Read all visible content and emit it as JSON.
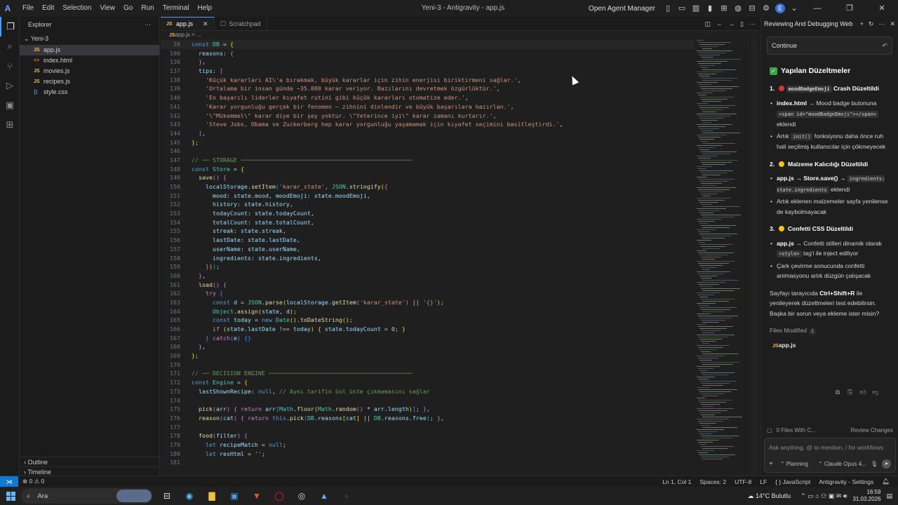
{
  "app": {
    "menu": [
      "File",
      "Edit",
      "Selection",
      "View",
      "Go",
      "Run",
      "Terminal",
      "Help"
    ],
    "window_title": "Yeni-3 - Antigravity - app.js",
    "open_agent_manager": "Open Agent Manager",
    "avatar_letter": "E"
  },
  "explorer": {
    "title": "Explorer",
    "folder": "Yeni-3",
    "files": [
      {
        "name": "app.js",
        "type": "JS"
      },
      {
        "name": "index.html",
        "type": "<>"
      },
      {
        "name": "movies.js",
        "type": "JS"
      },
      {
        "name": "recipes.js",
        "type": "JS"
      },
      {
        "name": "style.css",
        "type": "{}"
      }
    ],
    "outline": "Outline",
    "timeline": "Timeline"
  },
  "editor": {
    "tabs": [
      {
        "label": "app.js",
        "active": true
      },
      {
        "label": "Scratchpad",
        "active": false
      }
    ],
    "breadcrumb": "app.js > ...",
    "lines": [
      {
        "n": "20",
        "html": "<span class=\"kw\">const</span> <span class=\"cls\">DB</span> = <span class=\"brk\">{</span>"
      },
      {
        "n": "100",
        "html": "  <span class=\"var\">reasons</span>: <span class=\"brk2\">{</span>"
      },
      {
        "n": "136",
        "html": "  <span class=\"brk2\">}</span>,"
      },
      {
        "n": "137",
        "html": "  <span class=\"var\">tips</span>: <span class=\"brk2\">[</span>"
      },
      {
        "n": "138",
        "html": "    <span class=\"str\">'Küçük kararları AI\\'a bırakmak, büyük kararlar için zihin enerjisi biriktirmeni sağlar.'</span>,"
      },
      {
        "n": "139",
        "html": "    <span class=\"str\">'Ortalama bir insan günde ~35.000 karar veriyor. Bazılarını devretmek özgürlüktür.'</span>,"
      },
      {
        "n": "140",
        "html": "    <span class=\"str\">'En başarılı liderler kıyafet rutini gibi küçük kararları otomatize eder.'</span>,"
      },
      {
        "n": "141",
        "html": "    <span class=\"str\">'Karar yorgunluğu gerçek bir fenomen — zihnini dinlendir ve büyük başarılara hazırlan.'</span>,"
      },
      {
        "n": "142",
        "html": "    <span class=\"str\">'\\\"Mükemmel\\\" karar diye bir şey yoktur. \\\"Yeterince iyi\\\" karar zamanı kurtarır.'</span>,"
      },
      {
        "n": "143",
        "html": "    <span class=\"str\">'Steve Jobs, Obama ve Zuckerberg hep karar yorgunluğu yaşamamak için kıyafet seçimini basitleştirdi.'</span>,"
      },
      {
        "n": "144",
        "html": "  <span class=\"brk2\">]</span>,"
      },
      {
        "n": "145",
        "html": "<span class=\"brk\">}</span>;"
      },
      {
        "n": "146",
        "html": ""
      },
      {
        "n": "147",
        "html": "<span class=\"com\">// ── STORAGE ─────────────────────────────────────────────────</span>"
      },
      {
        "n": "148",
        "html": "<span class=\"kw\">const</span> <span class=\"cls\">Store</span> = <span class=\"brk\">{</span>"
      },
      {
        "n": "149",
        "html": "  <span class=\"fn\">save</span><span class=\"brk2\">()</span> <span class=\"brk2\">{</span>"
      },
      {
        "n": "150",
        "html": "    <span class=\"var\">localStorage</span>.<span class=\"fn\">setItem</span><span class=\"brk3\">(</span><span class=\"str\">'karar_state'</span>, <span class=\"cls\">JSON</span>.<span class=\"fn\">stringify</span><span class=\"brk\">(</span><span class=\"brk2\">{</span>"
      },
      {
        "n": "151",
        "html": "      <span class=\"var\">mood</span>: <span class=\"var\">state</span>.<span class=\"var\">mood</span>, <span class=\"var\">moodEmoji</span>: <span class=\"var\">state</span>.<span class=\"var\">moodEmoji</span>,"
      },
      {
        "n": "152",
        "html": "      <span class=\"var\">history</span>: <span class=\"var\">state</span>.<span class=\"var\">history</span>,"
      },
      {
        "n": "153",
        "html": "      <span class=\"var\">todayCount</span>: <span class=\"var\">state</span>.<span class=\"var\">todayCount</span>,"
      },
      {
        "n": "154",
        "html": "      <span class=\"var\">totalCount</span>: <span class=\"var\">state</span>.<span class=\"var\">totalCount</span>,"
      },
      {
        "n": "155",
        "html": "      <span class=\"var\">streak</span>: <span class=\"var\">state</span>.<span class=\"var\">streak</span>,"
      },
      {
        "n": "156",
        "html": "      <span class=\"var\">lastDate</span>: <span class=\"var\">state</span>.<span class=\"var\">lastDate</span>,"
      },
      {
        "n": "157",
        "html": "      <span class=\"var\">userName</span>: <span class=\"var\">state</span>.<span class=\"var\">userName</span>,"
      },
      {
        "n": "158",
        "html": "      <span class=\"var\">ingredients</span>: <span class=\"var\">state</span>.<span class=\"var\">ingredients</span>,"
      },
      {
        "n": "159",
        "html": "    <span class=\"brk2\">}</span><span class=\"brk\">)</span><span class=\"brk3\">)</span>;"
      },
      {
        "n": "160",
        "html": "  <span class=\"brk2\">}</span>,"
      },
      {
        "n": "161",
        "html": "  <span class=\"fn\">load</span><span class=\"brk2\">()</span> <span class=\"brk2\">{</span>"
      },
      {
        "n": "162",
        "html": "    <span class=\"kw2\">try</span> <span class=\"brk3\">{</span>"
      },
      {
        "n": "163",
        "html": "      <span class=\"kw\">const</span> <span class=\"var\">d</span> = <span class=\"cls\">JSON</span>.<span class=\"fn\">parse</span><span class=\"brk\">(</span><span class=\"var\">localStorage</span>.<span class=\"fn\">getItem</span><span class=\"brk2\">(</span><span class=\"str\">'karar_state'</span><span class=\"brk2\">)</span> || <span class=\"str\">'{}'</span><span class=\"brk\">)</span>;"
      },
      {
        "n": "164",
        "html": "      <span class=\"cls\">Object</span>.<span class=\"fn\">assign</span><span class=\"brk\">(</span><span class=\"var\">state</span>, <span class=\"var\">d</span><span class=\"brk\">)</span>;"
      },
      {
        "n": "165",
        "html": "      <span class=\"kw\">const</span> <span class=\"var\">today</span> = <span class=\"kw\">new</span> <span class=\"cls\">Date</span><span class=\"brk\">()</span>.<span class=\"fn\">toDateString</span><span class=\"brk\">()</span>;"
      },
      {
        "n": "166",
        "html": "      <span class=\"kw2\">if</span> <span class=\"brk\">(</span><span class=\"var\">state</span>.<span class=\"var\">lastDate</span> !== <span class=\"var\">today</span><span class=\"brk\">)</span> <span class=\"brk\">{</span> <span class=\"var\">state</span>.<span class=\"var\">todayCount</span> = <span class=\"num\">0</span>; <span class=\"brk\">}</span>"
      },
      {
        "n": "167",
        "html": "    <span class=\"brk3\">}</span> <span class=\"kw2\">catch</span><span class=\"brk3\">(</span><span class=\"var\">e</span><span class=\"brk3\">)</span> <span class=\"brk3\">{}</span>"
      },
      {
        "n": "168",
        "html": "  <span class=\"brk2\">}</span>,"
      },
      {
        "n": "169",
        "html": "<span class=\"brk\">}</span>;"
      },
      {
        "n": "170",
        "html": ""
      },
      {
        "n": "171",
        "html": "<span class=\"com\">// ── DECISION ENGINE ─────────────────────────────────────────</span>"
      },
      {
        "n": "172",
        "html": "<span class=\"kw\">const</span> <span class=\"cls\">Engine</span> = <span class=\"brk\">{</span>"
      },
      {
        "n": "173",
        "html": "  <span class=\"var\">lastShownRecipe</span>: <span class=\"kw\">null</span>, <span class=\"com\">// Aynı tarifin üst üste çıkmamasını sağlar</span>"
      },
      {
        "n": "174",
        "html": ""
      },
      {
        "n": "175",
        "html": "  <span class=\"fn\">pick</span><span class=\"brk2\">(</span><span class=\"var\">arr</span><span class=\"brk2\">)</span> <span class=\"brk2\">{</span> <span class=\"kw2\">return</span> <span class=\"var\">arr</span><span class=\"brk3\">[</span><span class=\"cls\">Math</span>.<span class=\"fn\">floor</span><span class=\"brk\">(</span><span class=\"cls\">Math</span>.<span class=\"fn\">random</span><span class=\"brk2\">()</span> * <span class=\"var\">arr</span>.<span class=\"var\">length</span><span class=\"brk\">)</span><span class=\"brk3\">]</span>; <span class=\"brk2\">}</span>,"
      },
      {
        "n": "176",
        "html": "  <span class=\"fn\">reason</span><span class=\"brk2\">(</span><span class=\"var\">cat</span><span class=\"brk2\">)</span> <span class=\"brk2\">{</span> <span class=\"kw2\">return</span> <span class=\"kw\">this</span>.<span class=\"fn\">pick</span><span class=\"brk3\">(</span><span class=\"cls\">DB</span>.<span class=\"var\">reasons</span><span class=\"brk\">[</span><span class=\"var\">cat</span><span class=\"brk\">]</span> || <span class=\"cls\">DB</span>.<span class=\"var\">reasons</span>.<span class=\"var\">free</span><span class=\"brk3\">)</span>; <span class=\"brk2\">}</span>,"
      },
      {
        "n": "177",
        "html": ""
      },
      {
        "n": "178",
        "html": "  <span class=\"fn\">food</span><span class=\"brk2\">(</span><span class=\"var\">filter</span><span class=\"brk2\">)</span> <span class=\"brk2\">{</span>"
      },
      {
        "n": "179",
        "html": "    <span class=\"kw\">let</span> <span class=\"var\">recipeMatch</span> = <span class=\"kw\">null</span>;"
      },
      {
        "n": "180",
        "html": "    <span class=\"kw\">let</span> <span class=\"var\">resHtml</span> = <span class=\"str\">''</span>;"
      },
      {
        "n": "181",
        "html": ""
      }
    ]
  },
  "agent": {
    "title": "Reviewing And Debugging Web",
    "continue_label": "Continue",
    "heading": "Yapılan Düzeltmeler",
    "s1_num": "1.",
    "s1_chip": "moodBadgeEmoji",
    "s1_title": "Crash Düzeltildi",
    "s1_b1_file": "index.html",
    "s1_b1_text": "→ Mood badge butonuna",
    "s1_b1_code": "<span id=\"moodBadgeEmoji\"></span>",
    "s1_b1_end": "eklendi",
    "s1_b2_pre": "Artık",
    "s1_b2_code": "init()",
    "s1_b2_text": "fonksiyonu daha önce ruh hali seçilmiş kullanıcılar için çökmeyecek",
    "s2_num": "2.",
    "s2_title": "Malzeme Kalıcılığı Düzeltildi",
    "s2_b1_file": "app.js → Store.save() →",
    "s2_b1_code": "ingredients: state.ingredients",
    "s2_b1_end": "eklendi",
    "s2_b2_text": "Artık eklenen malzemeler sayfa yenilense de kaybolmayacak",
    "s3_num": "3.",
    "s3_title": "Confetti CSS Düzeltildi",
    "s3_b1_file": "app.js",
    "s3_b1_text": "→ Confetti stilleri dinamik olarak",
    "s3_b1_code": "<style>",
    "s3_b1_end": "tag'i ile inject ediliyor",
    "s3_b2_text": "Çark çevirme sonucunda confetti animasyonu artık düzgün çalışacak",
    "closing_pre": "Sayfayı tarayıcıda",
    "closing_keys": "Ctrl+Shift+R",
    "closing_post": "ile yenileyerek düzeltmeleri test edebilirsin. Başka bir sorun veya ekleme ister misin?",
    "files_modified_label": "Files Modified",
    "files_modified_count": "1",
    "files_modified_file": "app.js",
    "files_with_changes": "0 Files With C...",
    "review_changes": "Review Changes",
    "ask_placeholder": "Ask anything, @ to mention, / for workflows",
    "mode": "Planning",
    "model": "Claude Opus 4..."
  },
  "statusbar": {
    "errors": "⊗ 0 ⚠ 0",
    "position": "Ln 1, Col 1",
    "spaces": "Spaces: 2",
    "encoding": "UTF-8",
    "eol": "LF",
    "language": "{ } JavaScript",
    "settings": "Antigravity - Settings"
  },
  "taskbar": {
    "search_label": "Ara",
    "weather": "14°C  Bulutlu",
    "time": "16:59",
    "date": "31.03.2026"
  }
}
